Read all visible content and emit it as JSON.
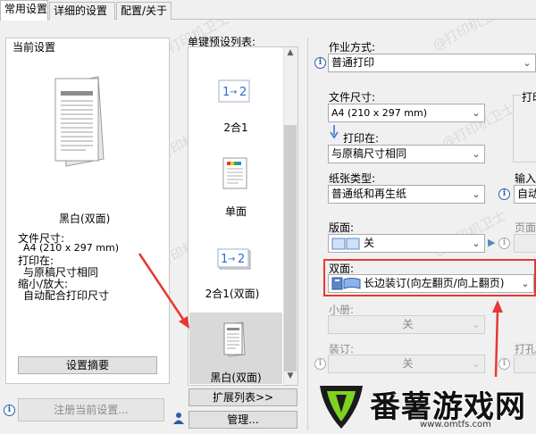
{
  "tabs": [
    {
      "label": "常用设置"
    },
    {
      "label": "详细的设置"
    },
    {
      "label": "配置/关于"
    }
  ],
  "current_settings": {
    "title": "当前设置",
    "color_mode": "黑白(双面)",
    "paper_size_label": "文件尺寸:",
    "paper_size_value": "A4 (210 x 297 mm)",
    "print_on_label": "打印在:",
    "print_on_value": "与原稿尺寸相同",
    "scale_label": "缩小/放大:",
    "scale_value": "自动配合打印尺寸",
    "summary_button": "设置摘要"
  },
  "register_button": "注册当前设置...",
  "presets": {
    "title": "单键预设列表:",
    "items": [
      {
        "label": "2合1"
      },
      {
        "label": "单面"
      },
      {
        "label": "2合1(双面)"
      },
      {
        "label": "黑白(双面)"
      }
    ],
    "expand_button": "扩展列表>>",
    "manage_button": "管理..."
  },
  "settings": {
    "job_type_label": "作业方式:",
    "job_type_value": "普通打印",
    "paper_size_label": "文件尺寸:",
    "paper_size_value": "A4 (210 x 297 mm)",
    "print_on_label": "打印在:",
    "print_on_value": "与原稿尺寸相同",
    "paper_type_label": "纸张类型:",
    "paper_type_value": "普通纸和再生纸",
    "layout_label": "版面:",
    "layout_value": "关",
    "duplex_label": "双面:",
    "duplex_value": "长边装订(向左翻页/向上翻页)",
    "booklet_label": "小册:",
    "booklet_value": "关",
    "binding_label": "装订:",
    "binding_value": "关",
    "orientation_label_partial": "打印",
    "input_tray_label_partial": "输入",
    "input_tray_value_partial": "自动",
    "page_order_label_partial": "页面",
    "punch_label_partial": "打孔"
  },
  "watermark": {
    "text": "@打印机卫士"
  },
  "overlay": {
    "logo_text": "番薯游戏网",
    "logo_url": "www.omtfs.com"
  },
  "colors": {
    "highlight": "#e53935",
    "accent_blue": "#2a5ea8"
  }
}
